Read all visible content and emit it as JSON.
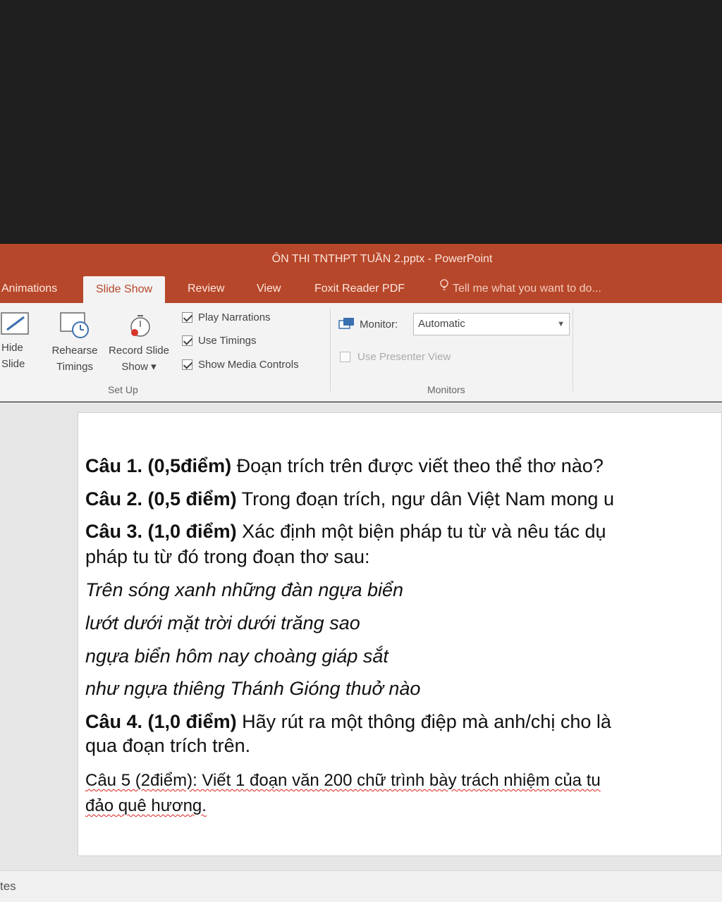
{
  "window": {
    "title": "ÔN THI TNTHPT TUẦN 2.pptx - PowerPoint"
  },
  "tabs": [
    {
      "label": "Animations"
    },
    {
      "label": "Slide Show"
    },
    {
      "label": "Review"
    },
    {
      "label": "View"
    },
    {
      "label": "Foxit Reader PDF"
    }
  ],
  "tell_me": "Tell me what you want to do...",
  "ribbon": {
    "hide_slide": {
      "line1": "Hide",
      "line2": "Slide"
    },
    "rehearse": {
      "line1": "Rehearse",
      "line2": "Timings"
    },
    "record": {
      "line1": "Record Slide",
      "line2": "Show ▾"
    },
    "checks": {
      "play_narrations": "Play Narrations",
      "use_timings": "Use Timings",
      "show_media_controls": "Show Media Controls"
    },
    "setup_label": "Set Up",
    "monitor_label": "Monitor:",
    "monitor_value": "Automatic",
    "presenter_view": "Use Presenter View",
    "monitors_label": "Monitors"
  },
  "slide": {
    "q1_bold": "Câu 1. (0,5điểm)",
    "q1_text": " Đoạn trích trên được viết theo thể thơ nào?",
    "q2_bold": "Câu 2. (0,5 điểm)",
    "q2_text": " Trong đoạn trích, ngư dân Việt Nam mong u",
    "q3_bold": "Câu 3. (1,0 điểm)",
    "q3_text": " Xác định một biện pháp tu từ và nêu tác dụ",
    "q3_cont": "pháp tu từ đó trong đoạn thơ sau:",
    "poem1": "Trên sóng xanh những đàn ngựa biển",
    "poem2": "lướt dưới mặt trời dưới trăng sao",
    "poem3": "ngựa biển hôm nay choàng giáp sắt",
    "poem4": "như ngựa thiêng Thánh Gióng thuở nào",
    "q4_bold": "Câu 4. (1,0 điểm)",
    "q4_text": " Hãy rút ra một thông điệp mà anh/chị cho là",
    "q4_cont": "qua đoạn trích trên.",
    "q5_line1": "Câu 5 (2điểm): Viết 1 đoạn văn 200 chữ trình bày trách nhiệm của tu",
    "q5_line2": "đảo quê hương."
  },
  "status": {
    "notes": "tes"
  }
}
